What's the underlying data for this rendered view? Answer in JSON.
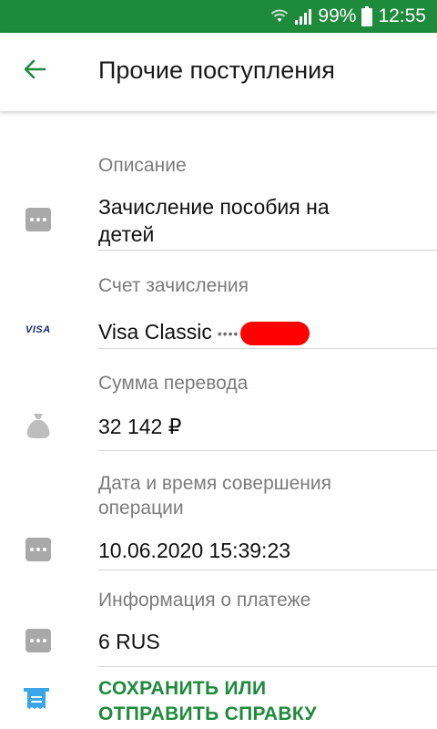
{
  "status_bar": {
    "battery": "99%",
    "time": "12:55"
  },
  "header": {
    "title": "Прочие поступления",
    "back_icon": "arrow-left-icon"
  },
  "fields": {
    "description": {
      "label": "Описание",
      "value_line1": "Зачисление пособия на",
      "value_line2": "детей",
      "icon": "more-dots-icon"
    },
    "account": {
      "label": "Счет зачисления",
      "card_brand": "VISA",
      "value": "Visa Classic",
      "masked": "••••",
      "icon": "visa-icon"
    },
    "amount": {
      "label": "Сумма перевода",
      "value": "32 142 ₽",
      "icon": "money-bag-icon"
    },
    "datetime": {
      "label_line1": "Дата и время совершения",
      "label_line2": "операции",
      "value": "10.06.2020 15:39:23",
      "icon": "more-dots-icon"
    },
    "payment_info": {
      "label": "Информация о платеже",
      "value": "6 RUS",
      "icon": "more-dots-icon"
    }
  },
  "action": {
    "label_line1": "СОХРАНИТЬ ИЛИ",
    "label_line2": "ОТПРАВИТЬ СПРАВКУ",
    "icon": "receipt-icon"
  },
  "colors": {
    "accent": "#1e8a3c",
    "icon_gray": "#a9a9a9",
    "receipt_blue": "#3aa6e8",
    "redaction": "#ff0000"
  }
}
